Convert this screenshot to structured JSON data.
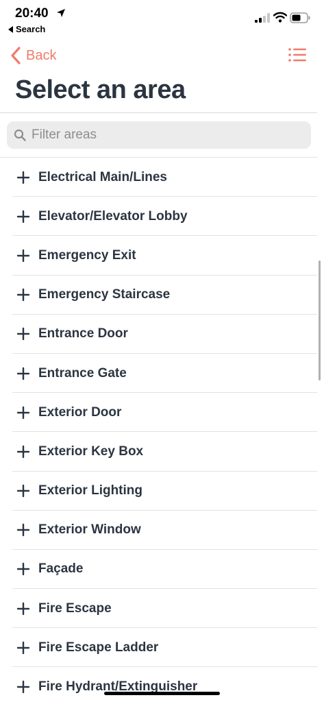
{
  "status_bar": {
    "time": "20:40",
    "back_app": "Search"
  },
  "nav": {
    "back_label": "Back",
    "accent_color": "#f07a69"
  },
  "page_title": "Select an area",
  "search": {
    "placeholder": "Filter areas",
    "value": ""
  },
  "areas": [
    "Electrical Main/Lines",
    "Elevator/Elevator Lobby",
    "Emergency Exit",
    "Emergency Staircase",
    "Entrance Door",
    "Entrance Gate",
    "Exterior Door",
    "Exterior Key Box",
    "Exterior Lighting",
    "Exterior Window",
    "Façade",
    "Fire Escape",
    "Fire Escape Ladder",
    "Fire Hydrant/Extinguisher"
  ]
}
